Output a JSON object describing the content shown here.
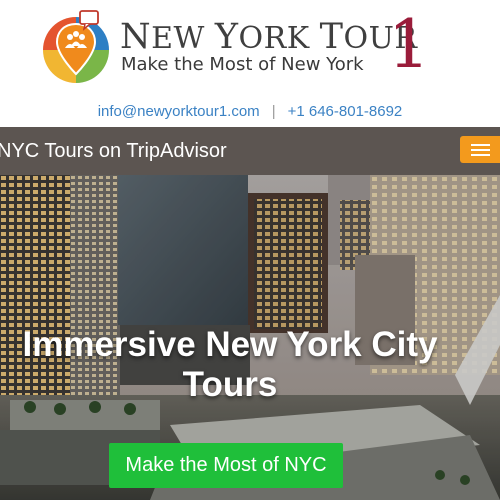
{
  "brand": {
    "name_parts": [
      "N",
      "EW ",
      "Y",
      "ORK ",
      "T",
      "OUR"
    ],
    "number": "1",
    "tagline": "Make the Most of New York"
  },
  "contact": {
    "email": "info@newyorktour1.com",
    "separator": "|",
    "phone": "+1 646-801-8692"
  },
  "navbar": {
    "link": "NYC Tours on TripAdvisor",
    "menu_icon": "hamburger-icon"
  },
  "hero": {
    "title": "Immersive New York City Tours",
    "cta": "Make the Most of NYC"
  },
  "colors": {
    "link": "#3b82c4",
    "nav_bg": "#5c5551",
    "menu": "#f39a1d",
    "cta": "#1fbf3a",
    "brand_accent": "#9a1c3a"
  }
}
